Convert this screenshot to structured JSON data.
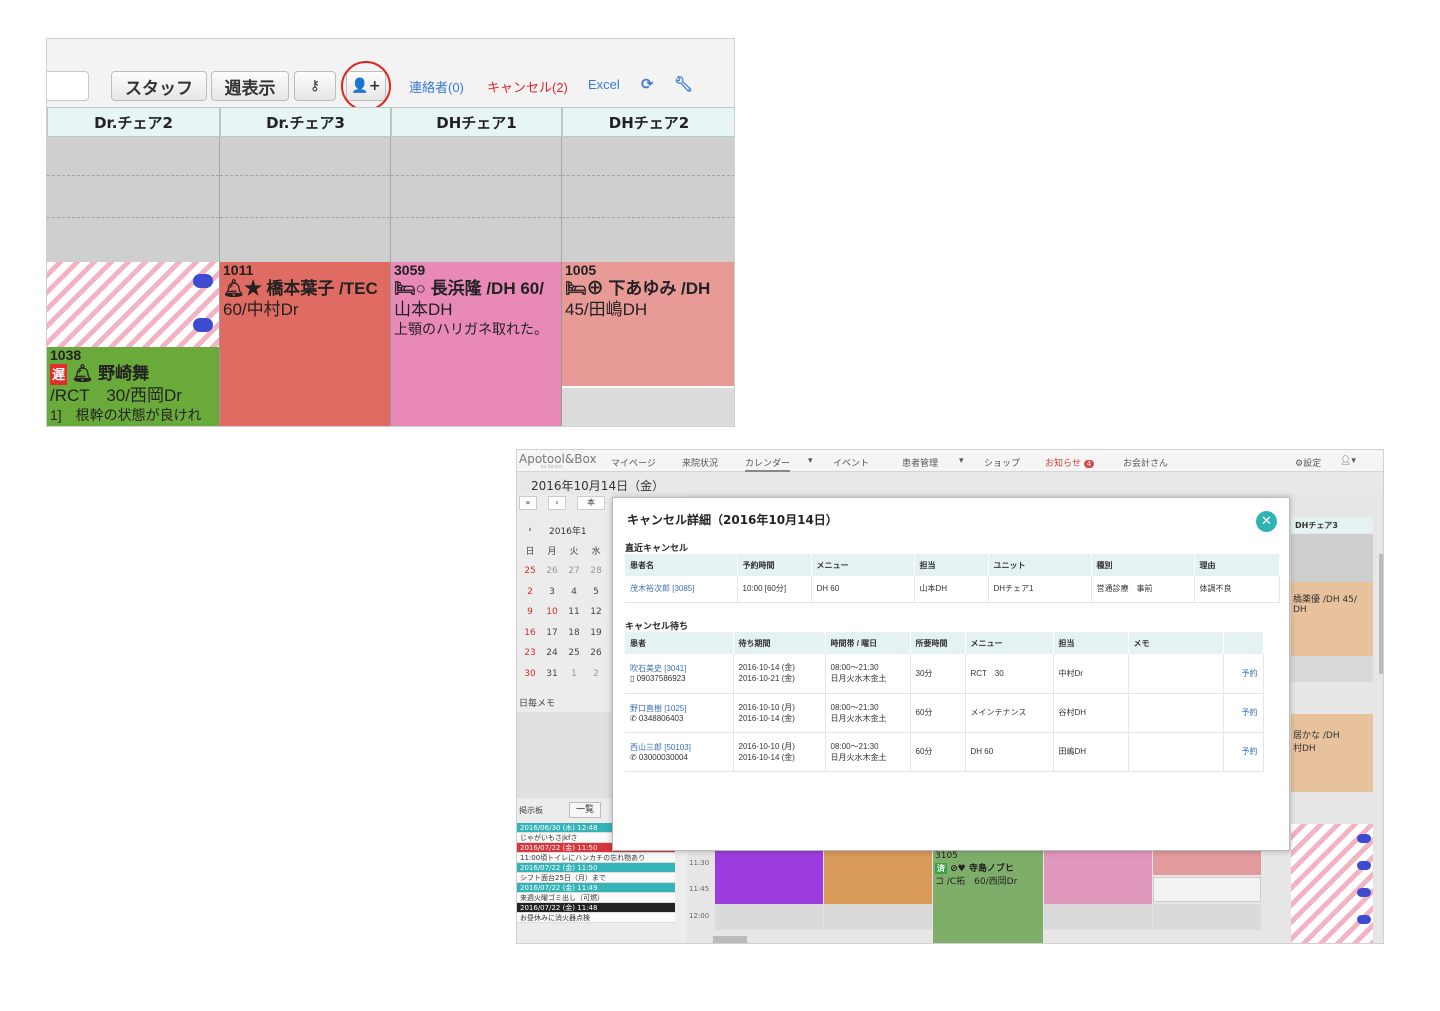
{
  "top": {
    "toolbar": {
      "staff_label": "スタッフ",
      "week_label": "週表示",
      "contacts_link": "連絡者(0)",
      "cancel_link": "キャンセル(2)",
      "excel_link": "Excel",
      "cancel_color": "#e0242b",
      "link_color": "#3a7bd5"
    },
    "columns": [
      "Dr.チェア2",
      "Dr.チェア3",
      "DHチェア1",
      "DHチェア2"
    ],
    "appointments": {
      "a1038": {
        "number": "1038",
        "late": "遅",
        "name": "野崎舞",
        "detail": "/RCT　30/西岡Dr",
        "note": "1]　根幹の状態が良けれ",
        "color": "#6aaa3a"
      },
      "a1011": {
        "number": "1011",
        "name": "橋本葉子 /TEC",
        "detail": "60/中村Dr",
        "color": "#df6b63"
      },
      "a3059": {
        "number": "3059",
        "name": "長浜隆 /DH 60/",
        "detail": "山本DH",
        "note": "上顎のハリガネ取れた。",
        "color": "#e889b8"
      },
      "a1005": {
        "number": "1005",
        "name": "下あゆみ /DH",
        "detail": "45/田嶋DH",
        "color": "#e89a97"
      }
    }
  },
  "bottom": {
    "nav": {
      "logo": "Apotool&Box",
      "logo_sub": "for Dentist",
      "items": [
        "マイページ",
        "来院状況",
        "カレンダー",
        "イベント",
        "患者管理",
        "ショップ",
        "お知らせ",
        "お会計さん"
      ],
      "notice_count": "4",
      "settings": "⚙設定"
    },
    "date_title": "2016年10月14日（金）",
    "mini_cal": {
      "month": "2016年1",
      "weekdays": [
        "日",
        "月",
        "火",
        "水"
      ],
      "weeks": [
        [
          "25",
          "26",
          "27",
          "28"
        ],
        [
          "2",
          "3",
          "4",
          "5"
        ],
        [
          "9",
          "10",
          "11",
          "12"
        ],
        [
          "16",
          "17",
          "18",
          "19"
        ],
        [
          "23",
          "24",
          "25",
          "26"
        ],
        [
          "30",
          "31",
          "1",
          "2"
        ]
      ]
    },
    "daily_memo": "日毎メモ",
    "board": {
      "label": "掲示板",
      "list_button": "一覧",
      "items": [
        {
          "text": "2016/06/30 (木) 12:48",
          "type": "teal"
        },
        {
          "text": "じゃがいもさjkfさ",
          "type": "plain"
        },
        {
          "text": "2016/07/22 (金) 11:50",
          "type": "red"
        },
        {
          "text": "11:00頃トイレにハンカチの忘れ物あり",
          "type": "plain"
        },
        {
          "text": "2016/07/22 (金) 11:50",
          "type": "teal"
        },
        {
          "text": "シフト面台25日（月）まで",
          "type": "plain"
        },
        {
          "text": "2016/07/22 (金) 11:49",
          "type": "teal"
        },
        {
          "text": "来週火曜ゴミ出し（可燃）",
          "type": "plain"
        },
        {
          "text": "2016/07/22 (金) 11:48",
          "type": "black"
        },
        {
          "text": "お昼休みに消火器点検",
          "type": "plain"
        }
      ]
    },
    "grid": {
      "times": [
        "11:30",
        "11:45",
        "12:00"
      ],
      "side_header": "DHチェア3",
      "side_appt1": "橋薬優 /DH 45/",
      "side_appt1b": "DH",
      "side_appt2": "居かな /DH",
      "side_appt2b": "村DH",
      "bottom_appt_num": "3105",
      "bottom_appt_name": "⊘♥ 寺島ノブヒ",
      "bottom_appt_detail": "コ /C拓　60/西岡Dr",
      "colors": {
        "purple": "#9c3ce0",
        "orange": "#d99a5a",
        "green": "#7fae6a",
        "pink": "#df97bc",
        "salmon": "#e29a9c",
        "peach": "#e8c29c"
      }
    },
    "modal": {
      "title": "キャンセル詳細（2016年10月14日）",
      "recent_title": "直近キャンセル",
      "recent_headers": [
        "患者名",
        "予約時間",
        "メニュー",
        "担当",
        "ユニット",
        "種別",
        "理由"
      ],
      "recent_rows": [
        [
          "茂木裕次郎 [3085]",
          "10:00 [60分]",
          "DH 60",
          "山本DH",
          "DHチェア1",
          "営通診療　事前",
          "体調不良"
        ]
      ],
      "waiting_title": "キャンセル待ち",
      "waiting_headers": [
        "患者",
        "待ち期間",
        "時間帯 / 曜日",
        "所要時間",
        "メニュー",
        "担当",
        "メモ",
        ""
      ],
      "waiting_rows": [
        {
          "name": "吹石美史 [3041]",
          "phone": "▯ 09037586923",
          "period1": "2016-10-14 (金)",
          "period2": "2016-10-21 (金)",
          "time": "08:00〜21:30",
          "days": "日月火水木金土",
          "duration": "30分",
          "menu": "RCT　30",
          "staff": "中村Dr",
          "memo": "",
          "action": "予約"
        },
        {
          "name": "野口直樹 [1025]",
          "phone": "✆ 0348806403",
          "period1": "2016-10-10 (月)",
          "period2": "2016-10-14 (金)",
          "time": "08:00〜21:30",
          "days": "日月火水木金土",
          "duration": "60分",
          "menu": "メインテナンス",
          "staff": "谷村DH",
          "memo": "",
          "action": "予約"
        },
        {
          "name": "西山三郎 [50103]",
          "phone": "✆ 03000030004",
          "period1": "2016-10-10 (月)",
          "period2": "2016-10-14 (金)",
          "time": "08:00〜21:30",
          "days": "日月火水木金土",
          "duration": "60分",
          "menu": "DH 60",
          "staff": "田嶋DH",
          "memo": "",
          "action": "予約"
        }
      ]
    }
  }
}
